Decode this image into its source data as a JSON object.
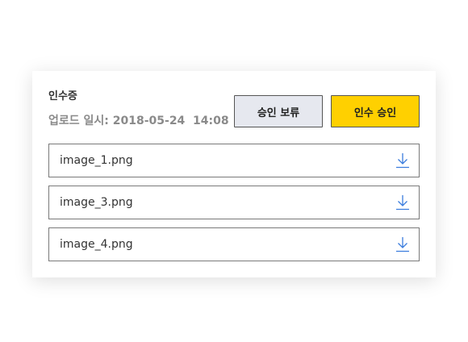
{
  "receipt": {
    "title": "인수증",
    "upload_meta": "업로드 일시: 2018-05-24  14:08"
  },
  "actions": {
    "hold_label": "승인 보류",
    "approve_label": "인수 승인",
    "approve_color": "#ffd000",
    "hold_color": "#e6e8ef"
  },
  "files": [
    {
      "name": "image_1.png",
      "icon": "download-icon"
    },
    {
      "name": "image_3.png",
      "icon": "download-icon"
    },
    {
      "name": "image_4.png",
      "icon": "download-icon"
    }
  ],
  "colors": {
    "download_icon": "#3b7ddd"
  }
}
